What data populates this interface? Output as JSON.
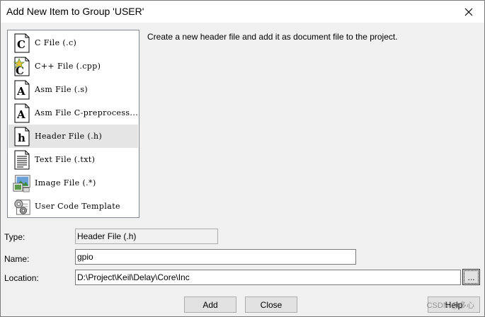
{
  "dialog": {
    "title": "Add New Item to Group 'USER'",
    "description": "Create a new header file and add it as document file to the project."
  },
  "file_types": [
    {
      "label": "C File (.c)",
      "icon": "c-file-icon"
    },
    {
      "label": "C++ File (.cpp)",
      "icon": "cpp-file-icon"
    },
    {
      "label": "Asm File (.s)",
      "icon": "asm-file-icon"
    },
    {
      "label": "Asm File C-preprocess...",
      "icon": "asm-preprocess-file-icon"
    },
    {
      "label": "Header File (.h)",
      "icon": "header-file-icon",
      "selected": true
    },
    {
      "label": "Text File (.txt)",
      "icon": "text-file-icon"
    },
    {
      "label": "Image File (.*)",
      "icon": "image-file-icon"
    },
    {
      "label": "User Code Template",
      "icon": "template-gear-icon"
    }
  ],
  "form": {
    "type_label": "Type:",
    "type_value": "Header File (.h)",
    "name_label": "Name:",
    "name_value": "gpio",
    "location_label": "Location:",
    "location_value": "D:\\Project\\Keil\\Delay\\Core\\Inc",
    "browse_label": "..."
  },
  "buttons": {
    "add": "Add",
    "close": "Close",
    "help": "Help"
  },
  "watermark": "CSDN @多心",
  "colors": {
    "selected_row": "#e5e5e5",
    "dialog_bg": "#f0f0f0",
    "list_border": "#828790"
  }
}
